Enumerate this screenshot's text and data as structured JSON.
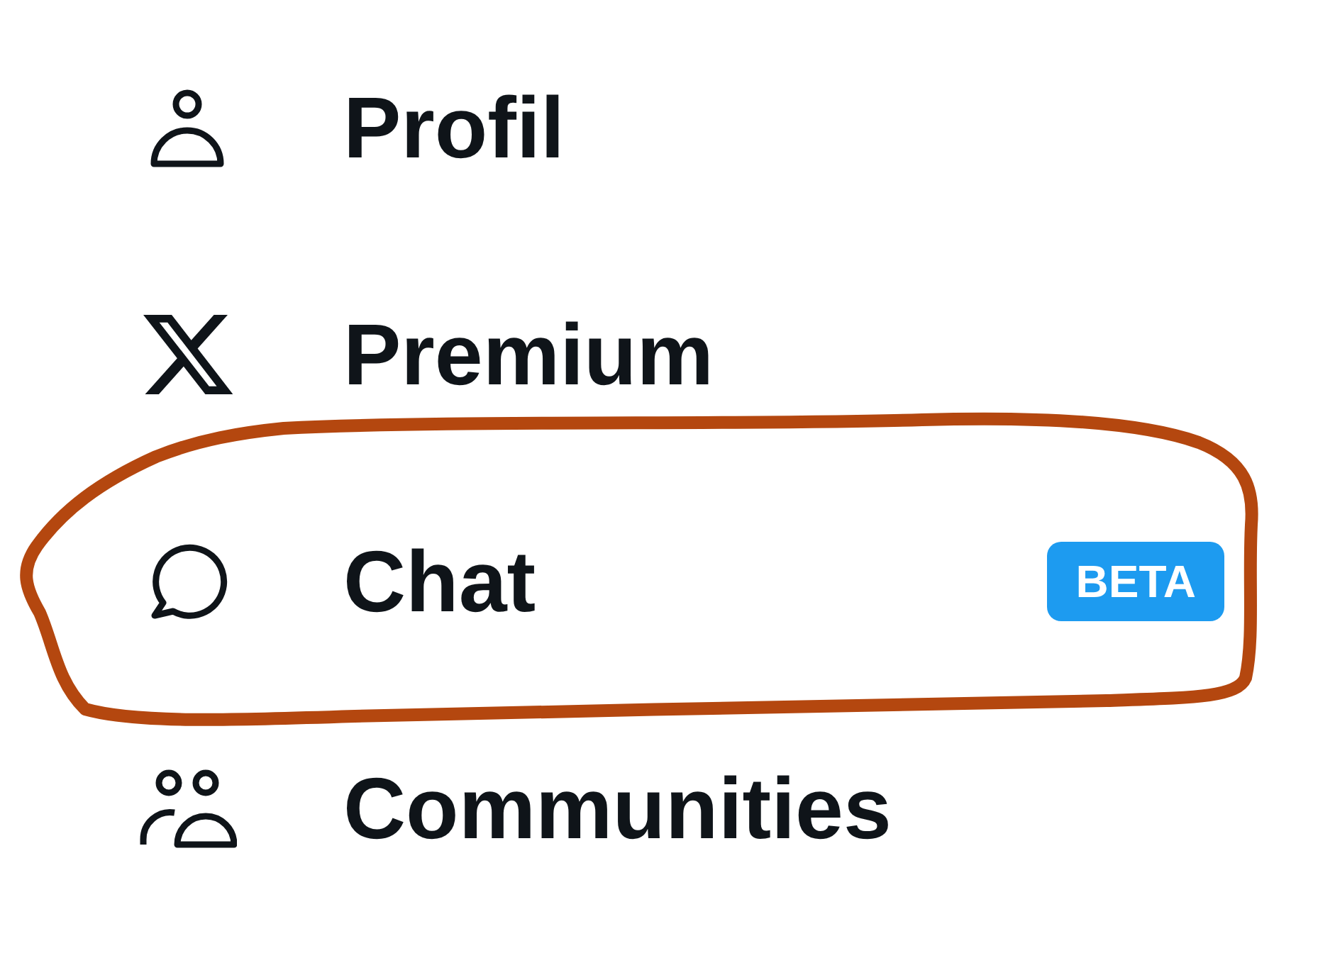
{
  "menu": {
    "items": [
      {
        "label": "Profil",
        "highlighted": false
      },
      {
        "label": "Premium",
        "highlighted": false
      },
      {
        "label": "Chat",
        "highlighted": true,
        "badge": "BETA"
      },
      {
        "label": "Communities",
        "highlighted": false
      }
    ]
  }
}
